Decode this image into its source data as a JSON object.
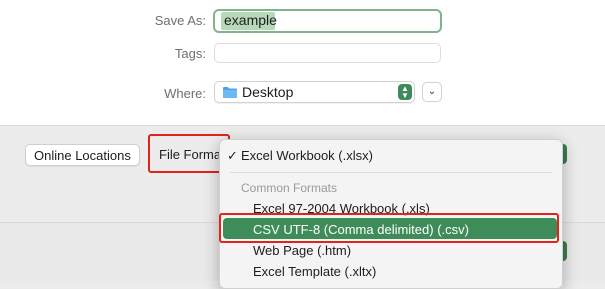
{
  "form": {
    "save_as_label": "Save As:",
    "save_as_value": "example",
    "tags_label": "Tags:",
    "where_label": "Where:",
    "where_value": "Desktop"
  },
  "buttons": {
    "online_locations": "Online Locations",
    "file_format_label": "File Forma"
  },
  "menu": {
    "selected_check": "✓",
    "current": "Excel Workbook (.xlsx)",
    "group_header": "Common Formats",
    "items": [
      "Excel 97-2004 Workbook (.xls)",
      "CSV UTF-8 (Comma delimited) (.csv)",
      "Web Page (.htm)",
      "Excel Template (.xltx)"
    ],
    "highlighted_index": 1
  },
  "colors": {
    "accent_green": "#3f8c5b",
    "annotation_red": "#e0241c",
    "focus_ring": "#7fb58a"
  },
  "icons": [
    "folder-icon",
    "stepper-icon",
    "chevron-down-icon",
    "checkmark-icon"
  ]
}
